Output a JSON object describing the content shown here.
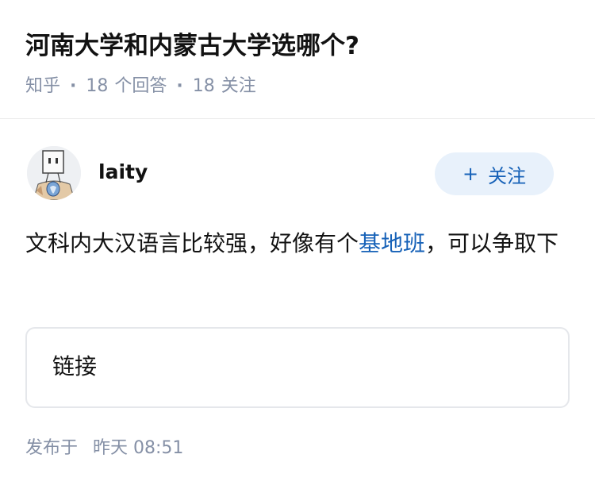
{
  "question": {
    "title": "河南大学和内蒙古大学选哪个?",
    "source": "知乎",
    "answers_count": "18",
    "answers_label": "个回答",
    "followers_count": "18",
    "followers_label": "关注",
    "separator": "·"
  },
  "author": {
    "name": "laity",
    "follow_plus": "+",
    "follow_label": "关注"
  },
  "answer": {
    "text_before": "文科内大汉语言比较强，好像有个",
    "link_text": "基地班",
    "text_after": "，可以争取下"
  },
  "link_card": {
    "label": "链接"
  },
  "publish": {
    "label": "发布于",
    "time": "昨天 08:51"
  },
  "colors": {
    "accent": "#1762b8",
    "meta_gray": "#8590a6",
    "follow_bg": "#e8f1fb"
  }
}
